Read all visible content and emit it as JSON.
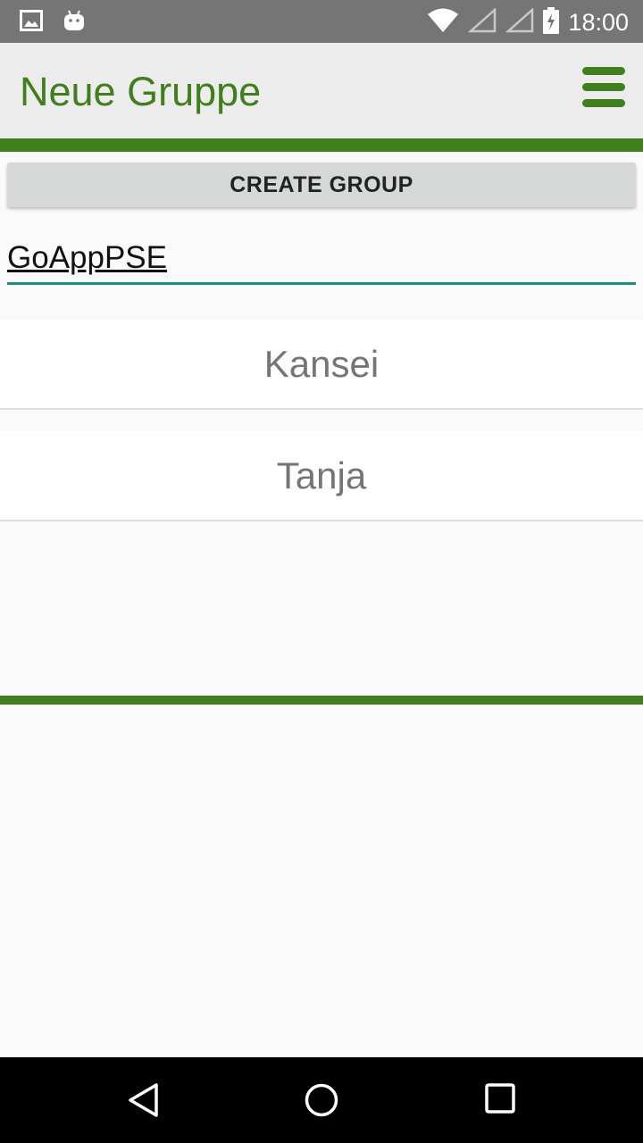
{
  "status_bar": {
    "time": "18:00",
    "icons": [
      "image-icon",
      "android-icon",
      "wifi-icon",
      "signal-icon",
      "signal-icon",
      "battery-charging-icon"
    ]
  },
  "app_bar": {
    "title": "Neue Gruppe",
    "menu_icon": "hamburger-menu-icon"
  },
  "colors": {
    "accent_green": "#3f7f1d",
    "input_underline": "#1a8f80",
    "button_bg": "#d6d7d7"
  },
  "actions": {
    "create_group_label": "CREATE GROUP"
  },
  "group_name_input": {
    "value": "GoAppPSE"
  },
  "members": [
    {
      "name": "Kansei"
    },
    {
      "name": "Tanja"
    }
  ],
  "nav_bar": {
    "icons": [
      "back-icon",
      "home-icon",
      "recents-icon"
    ]
  }
}
